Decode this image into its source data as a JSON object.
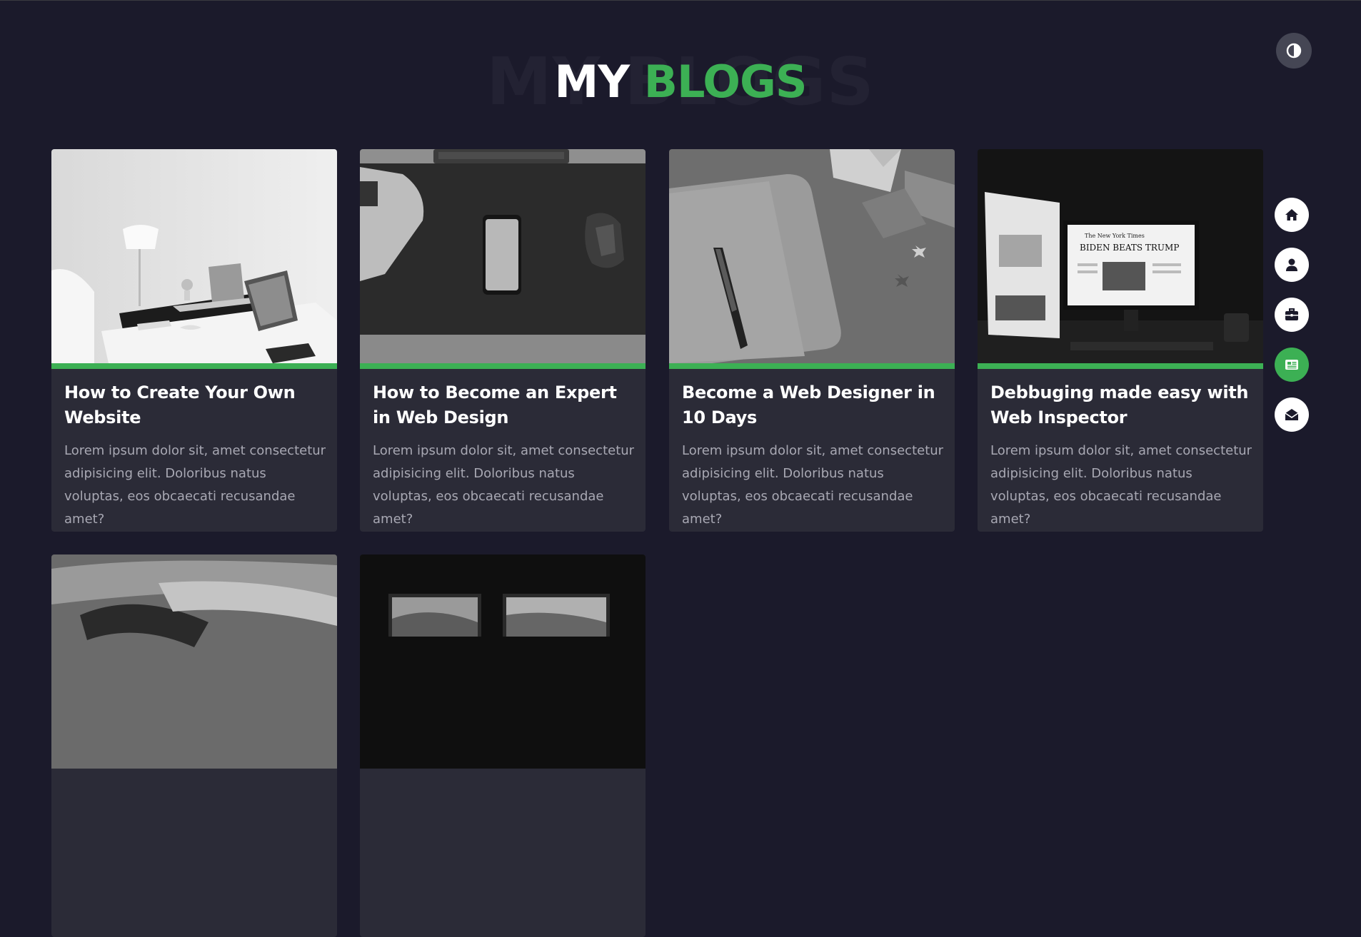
{
  "heading": {
    "bg_text": "MY BLOGS",
    "part1": "MY",
    "part2": "BLOGS"
  },
  "colors": {
    "accent": "#3cb054",
    "background": "#1b1a2b",
    "card": "#2b2b37"
  },
  "theme_toggle": {
    "icon": "contrast-icon"
  },
  "nav": [
    {
      "name": "home",
      "icon": "home-icon",
      "active": false
    },
    {
      "name": "about",
      "icon": "user-icon",
      "active": false
    },
    {
      "name": "portfolio",
      "icon": "briefcase-icon",
      "active": false
    },
    {
      "name": "blogs",
      "icon": "newspaper-icon",
      "active": true
    },
    {
      "name": "contact",
      "icon": "envelope-open-icon",
      "active": false
    }
  ],
  "blogs": [
    {
      "title": "How to Create Your Own Website",
      "desc": "Lorem ipsum dolor sit, amet consectetur adipisicing elit. Doloribus natus voluptas, eos obcaecati recusandae amet?"
    },
    {
      "title": "How to Become an Expert in Web Design",
      "desc": "Lorem ipsum dolor sit, amet consectetur adipisicing elit. Doloribus natus voluptas, eos obcaecati recusandae amet?"
    },
    {
      "title": "Become a Web Designer in 10 Days",
      "desc": "Lorem ipsum dolor sit, amet consectetur adipisicing elit. Doloribus natus voluptas, eos obcaecati recusandae amet?"
    },
    {
      "title": "Debbuging made easy with Web Inspector",
      "desc": "Lorem ipsum dolor sit, amet consectetur adipisicing elit. Doloribus natus voluptas, eos obcaecati recusandae amet?"
    }
  ],
  "image_texts": {
    "newspaper_headline": "BIDEN BEATS TRUMP",
    "newspaper_masthead": "The New York Times"
  }
}
